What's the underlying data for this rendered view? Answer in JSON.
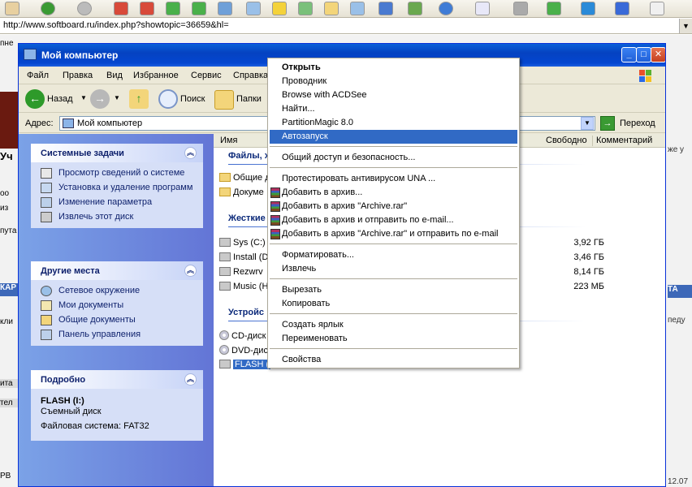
{
  "browser": {
    "url": "http://www.softboard.ru/index.php?showtopic=36659&hl=",
    "left_fragments": [
      "пне",
      "Уч",
      "оо",
      "из",
      "пута",
      "КАР",
      "кли",
      "ита",
      "тел",
      "РВ"
    ],
    "right_fragments": [
      "же у",
      "ТА",
      "педу",
      "12.07"
    ]
  },
  "window": {
    "title": "Мой компьютер",
    "buttons": {
      "minimize": "_",
      "maximize": "□",
      "close": "✕"
    }
  },
  "menubar": {
    "items": [
      "Файл",
      "Правка",
      "Вид",
      "Избранное",
      "Сервис",
      "Справка"
    ]
  },
  "toolbar": {
    "back": "Назад",
    "search": "Поиск",
    "folders": "Папки"
  },
  "address": {
    "label": "Адрес:",
    "value": "Мой компьютер",
    "go": "Переход"
  },
  "taskpane": {
    "system_tasks": {
      "title": "Системные задачи",
      "items": [
        "Просмотр сведений о системе",
        "Установка и удаление программ",
        "Изменение параметра",
        "Извлечь этот диск"
      ]
    },
    "other_places": {
      "title": "Другие места",
      "items": [
        "Сетевое окружение",
        "Мои документы",
        "Общие документы",
        "Панель управления"
      ]
    },
    "details": {
      "title": "Подробно",
      "name": "FLASH (I:)",
      "type": "Съемный диск",
      "fs": "Файловая система: FAT32"
    }
  },
  "filelist": {
    "columns": [
      "Имя",
      "Свободно",
      "Комментарий"
    ],
    "groups": {
      "files": "Файлы, х",
      "hard": "Жесткие",
      "removable": "Устройс"
    },
    "folders": [
      "Общие д",
      "Докуме"
    ],
    "drives": [
      {
        "name": "Sys (C:)",
        "free": "3,92 ГБ"
      },
      {
        "name": "Install (D",
        "free": "3,46 ГБ"
      },
      {
        "name": "Rezwrv",
        "free": "8,14 ГБ"
      },
      {
        "name": "Music (H",
        "free": "223 МБ"
      }
    ],
    "devices": [
      "CD-диск",
      "DVD-дис",
      "FLASH ("
    ]
  },
  "context_menu": {
    "items": [
      "Открыть",
      "Проводник",
      "Browse with ACDSee",
      "Найти...",
      "PartitionMagic 8.0",
      "Автозапуск",
      "Общий доступ и безопасность...",
      "Протестировать антивирусом UNA ...",
      "Добавить в архив...",
      "Добавить в архив \"Archive.rar\"",
      "Добавить в архив и отправить по e-mail...",
      "Добавить в архив \"Archive.rar\" и отправить по e-mail",
      "Форматировать...",
      "Извлечь",
      "Вырезать",
      "Копировать",
      "Создать ярлык",
      "Переименовать",
      "Свойства"
    ],
    "highlighted": "Автозапуск",
    "highlight_color": "#316ac5"
  }
}
